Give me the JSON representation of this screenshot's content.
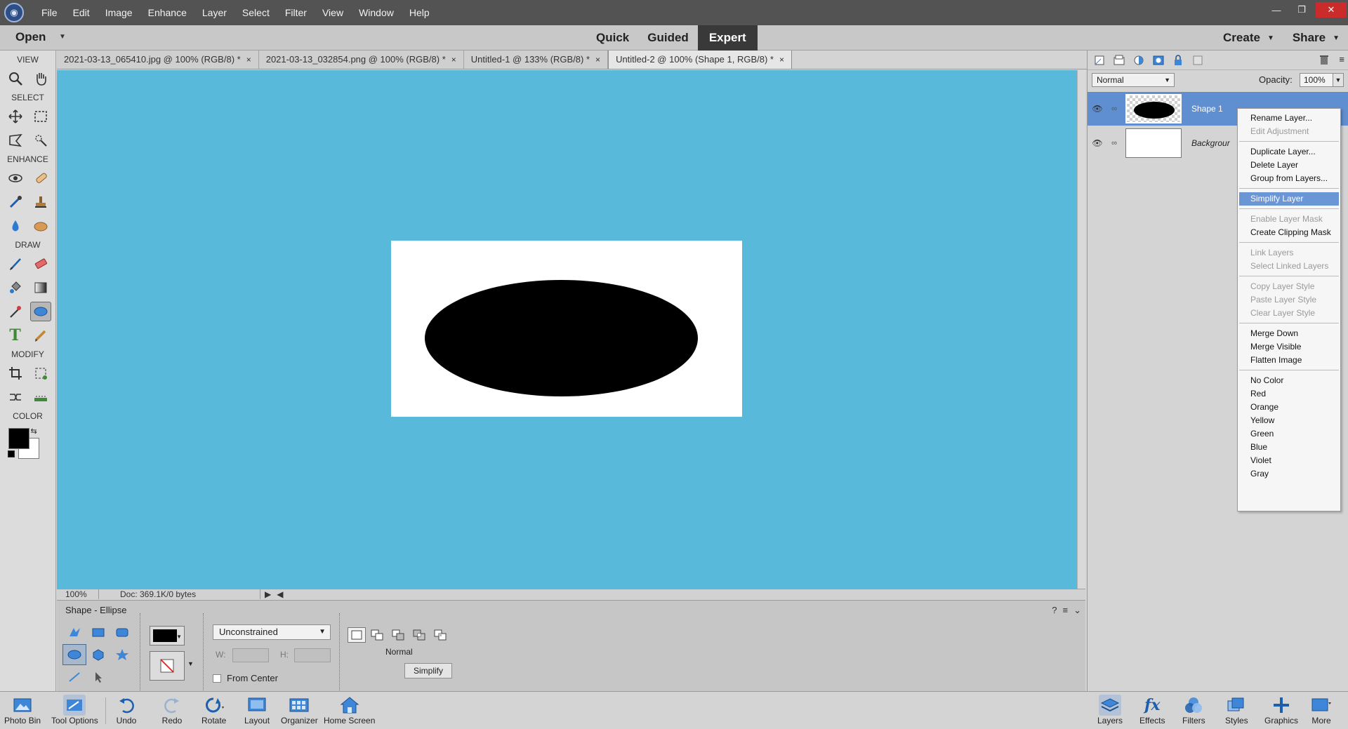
{
  "menubar": {
    "items": [
      "File",
      "Edit",
      "Image",
      "Enhance",
      "Layer",
      "Select",
      "Filter",
      "View",
      "Window",
      "Help"
    ]
  },
  "modebar": {
    "open": "Open",
    "modes": [
      "Quick",
      "Guided",
      "Expert"
    ],
    "active_mode": "Expert",
    "create": "Create",
    "share": "Share"
  },
  "toolbox": {
    "sections": [
      "VIEW",
      "SELECT",
      "ENHANCE",
      "DRAW",
      "MODIFY",
      "COLOR"
    ],
    "foreground_color": "#000000",
    "background_color": "#ffffff"
  },
  "tabs": [
    {
      "label": "2021-03-13_065410.jpg @ 100% (RGB/8) *"
    },
    {
      "label": "2021-03-13_032854.png @ 100% (RGB/8) *"
    },
    {
      "label": "Untitled-1 @ 133% (RGB/8) *"
    },
    {
      "label": "Untitled-2 @ 100% (Shape 1, RGB/8) *"
    }
  ],
  "canvas": {
    "background": "#58b9da"
  },
  "status": {
    "zoom": "100%",
    "doc": "Doc: 369.1K/0 bytes"
  },
  "tool_options": {
    "title": "Shape - Ellipse",
    "constraint": "Unconstrained",
    "w_label": "W:",
    "h_label": "H:",
    "from_center": "From Center",
    "mode_label": "Normal",
    "simplify": "Simplify"
  },
  "layers_panel": {
    "blend_mode": "Normal",
    "opacity_label": "Opacity:",
    "opacity_value": "100%",
    "layers": [
      {
        "name": "Shape 1",
        "selected": true
      },
      {
        "name": "Backgrour",
        "selected": false
      }
    ]
  },
  "context_menu": {
    "groups": [
      [
        {
          "label": "Rename Layer...",
          "enabled": true
        },
        {
          "label": "Edit Adjustment",
          "enabled": false
        }
      ],
      [
        {
          "label": "Duplicate Layer...",
          "enabled": true
        },
        {
          "label": "Delete Layer",
          "enabled": true
        },
        {
          "label": "Group from Layers...",
          "enabled": true
        }
      ],
      [
        {
          "label": "Simplify Layer",
          "enabled": true,
          "highlight": true
        }
      ],
      [
        {
          "label": "Enable Layer Mask",
          "enabled": false
        },
        {
          "label": "Create Clipping Mask",
          "enabled": true
        }
      ],
      [
        {
          "label": "Link Layers",
          "enabled": false
        },
        {
          "label": "Select Linked Layers",
          "enabled": false
        }
      ],
      [
        {
          "label": "Copy Layer Style",
          "enabled": false
        },
        {
          "label": "Paste Layer Style",
          "enabled": false
        },
        {
          "label": "Clear Layer Style",
          "enabled": false
        }
      ],
      [
        {
          "label": "Merge Down",
          "enabled": true
        },
        {
          "label": "Merge Visible",
          "enabled": true
        },
        {
          "label": "Flatten Image",
          "enabled": true
        }
      ],
      [
        {
          "label": "No Color",
          "enabled": true
        },
        {
          "label": "Red",
          "enabled": true
        },
        {
          "label": "Orange",
          "enabled": true
        },
        {
          "label": "Yellow",
          "enabled": true
        },
        {
          "label": "Green",
          "enabled": true
        },
        {
          "label": "Blue",
          "enabled": true
        },
        {
          "label": "Violet",
          "enabled": true
        },
        {
          "label": "Gray",
          "enabled": true
        }
      ]
    ]
  },
  "taskbar": {
    "left": [
      "Photo Bin",
      "Tool Options",
      "Undo",
      "Redo",
      "Rotate",
      "Layout",
      "Organizer",
      "Home Screen"
    ],
    "right": [
      "Layers",
      "Effects",
      "Filters",
      "Styles",
      "Graphics",
      "More"
    ]
  }
}
